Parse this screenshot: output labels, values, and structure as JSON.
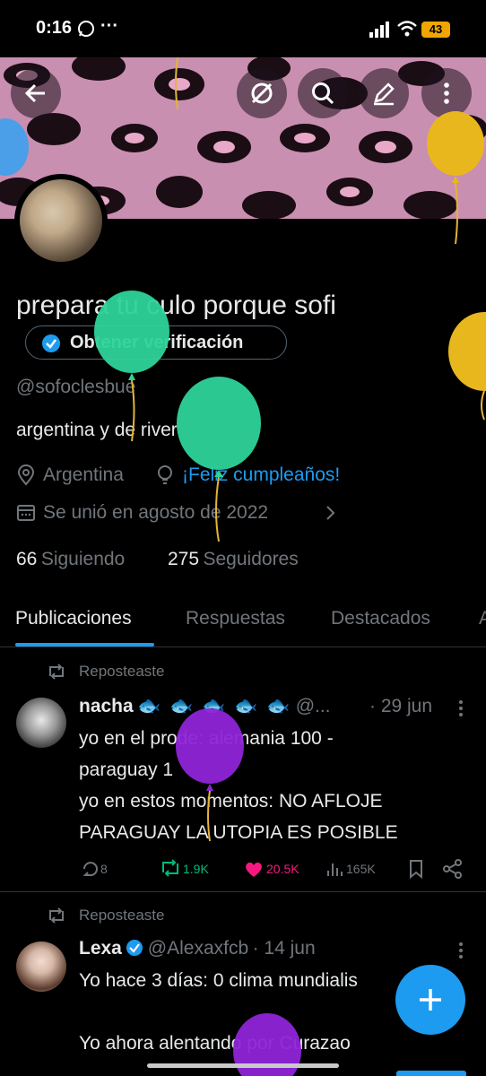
{
  "status_bar": {
    "time": "0:16",
    "more": "···",
    "battery": "43"
  },
  "profile": {
    "display_name": "prepara tu culo porque sofi",
    "verify_label": "Obtener verificación",
    "handle": "@sofoclesbue",
    "bio": "argentina y de river",
    "location": "Argentina",
    "birthday": "¡Feliz cumpleaños!",
    "joined": "Se unió en agosto de 2022",
    "following_count": "66",
    "following_label": "Siguiendo",
    "followers_count": "275",
    "followers_label": "Seguidores"
  },
  "tabs": [
    "Publicaciones",
    "Respuestas",
    "Destacados",
    "A"
  ],
  "posts": [
    {
      "repost_label": "Reposteaste",
      "name": "nacha",
      "handle": "@...",
      "date": "· 29 jun",
      "text": "yo en el prode: alemania 100 -\nparaguay 1\nyo en estos momentos: NO AFLOJE\nPARAGUAY LA UTOPIA ES POSIBLE",
      "replies": "8",
      "reposts": "1.9K",
      "likes": "20.5K",
      "views": "165K"
    },
    {
      "repost_label": "Reposteaste",
      "name": "Lexa",
      "handle": "@Alexaxfcb",
      "date": "· 14 jun",
      "text": "Yo hace 3 días: 0 clima mundialis\n\nYo ahora alentando por Curazao"
    }
  ],
  "colors": {
    "accent": "#1d9bf0",
    "like": "#f91880",
    "repost": "#00ba7c",
    "muted": "#71767b"
  }
}
